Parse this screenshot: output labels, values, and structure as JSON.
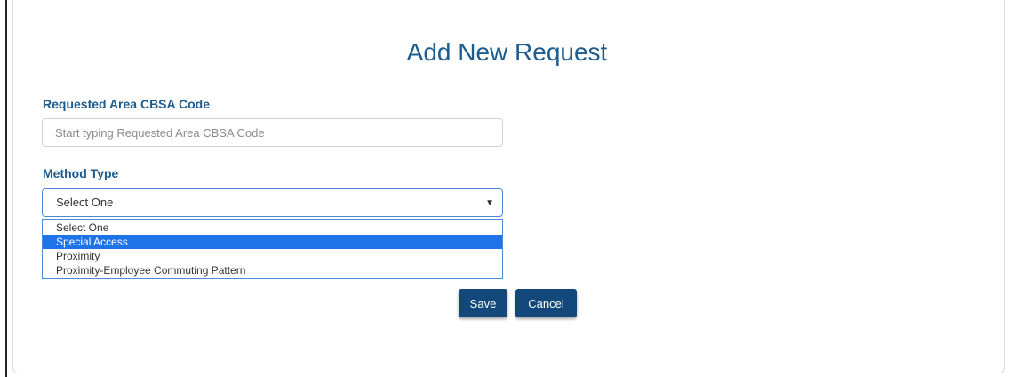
{
  "form": {
    "title": "Add New Request",
    "cbsa": {
      "label": "Requested Area CBSA Code",
      "placeholder": "Start typing Requested Area CBSA Code",
      "value": ""
    },
    "method": {
      "label": "Method Type",
      "selected": "Select One",
      "arrow_icon": "chevron-down-icon",
      "options": [
        "Select One",
        "Special Access",
        "Proximity",
        "Proximity-Employee Commuting Pattern"
      ],
      "highlighted_option": "Special Access"
    },
    "buttons": {
      "save_label": "Save",
      "cancel_label": "Cancel"
    }
  },
  "colors": {
    "heading": "#1d5c8e",
    "button": "#12497a",
    "highlight": "#1e73e8",
    "focus_border": "#4d8bd6"
  }
}
